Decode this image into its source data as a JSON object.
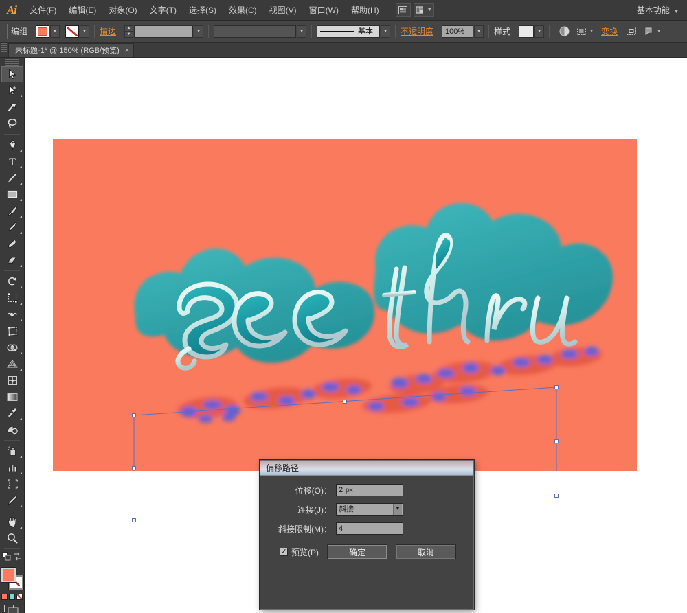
{
  "app": {
    "logo": "Ai",
    "workspace": "基本功能"
  },
  "menubar": {
    "items": [
      {
        "label": "文件(F)"
      },
      {
        "label": "编辑(E)"
      },
      {
        "label": "对象(O)"
      },
      {
        "label": "文字(T)"
      },
      {
        "label": "选择(S)"
      },
      {
        "label": "效果(C)"
      },
      {
        "label": "视图(V)"
      },
      {
        "label": "窗口(W)"
      },
      {
        "label": "帮助(H)"
      }
    ],
    "bridge_icon": "bridge-icon",
    "arrange_icon": "arrange-documents-icon"
  },
  "controlbar": {
    "selection_label": "编组",
    "fill_color": "#FA7A5E",
    "stroke_label": "描边",
    "stroke_weight": "",
    "profile_value": "",
    "brush_label": "基本",
    "opacity_label": "不透明度",
    "opacity_value": "100%",
    "style_label": "样式",
    "transform_label": "变换",
    "icons": [
      "opacity-mask-icon",
      "align-icon",
      "transform-icon",
      "isolate-icon",
      "flyout-icon"
    ]
  },
  "tabbar": {
    "document_title": "未标题-1* @ 150% (RGB/预览)",
    "close_glyph": "×"
  },
  "toolbar": {
    "tools": [
      {
        "name": "selection-tool",
        "active": true,
        "flyout": false
      },
      {
        "name": "direct-selection-tool",
        "active": false,
        "flyout": true
      },
      {
        "name": "magic-wand-tool",
        "active": false,
        "flyout": false
      },
      {
        "name": "lasso-tool",
        "active": false,
        "flyout": false
      },
      {
        "name": "pen-tool",
        "active": false,
        "flyout": true
      },
      {
        "name": "type-tool",
        "active": false,
        "flyout": true
      },
      {
        "name": "line-segment-tool",
        "active": false,
        "flyout": true
      },
      {
        "name": "rectangle-tool",
        "active": false,
        "flyout": true
      },
      {
        "name": "paintbrush-tool",
        "active": false,
        "flyout": true
      },
      {
        "name": "pencil-tool",
        "active": false,
        "flyout": true
      },
      {
        "name": "blob-brush-tool",
        "active": false,
        "flyout": false
      },
      {
        "name": "eraser-tool",
        "active": false,
        "flyout": true
      },
      {
        "name": "rotate-tool",
        "active": false,
        "flyout": true
      },
      {
        "name": "scale-tool",
        "active": false,
        "flyout": true
      },
      {
        "name": "width-tool",
        "active": false,
        "flyout": true
      },
      {
        "name": "free-transform-tool",
        "active": false,
        "flyout": false
      },
      {
        "name": "shape-builder-tool",
        "active": false,
        "flyout": true
      },
      {
        "name": "perspective-grid-tool",
        "active": false,
        "flyout": true
      },
      {
        "name": "mesh-tool",
        "active": false,
        "flyout": false
      },
      {
        "name": "gradient-tool",
        "active": false,
        "flyout": false
      },
      {
        "name": "eyedropper-tool",
        "active": false,
        "flyout": true
      },
      {
        "name": "blend-tool",
        "active": false,
        "flyout": false
      },
      {
        "name": "symbol-sprayer-tool",
        "active": false,
        "flyout": true
      },
      {
        "name": "column-graph-tool",
        "active": false,
        "flyout": true
      },
      {
        "name": "artboard-tool",
        "active": false,
        "flyout": false
      },
      {
        "name": "slice-tool",
        "active": false,
        "flyout": true
      },
      {
        "name": "hand-tool",
        "active": false,
        "flyout": true
      },
      {
        "name": "zoom-tool",
        "active": false,
        "flyout": false
      }
    ],
    "fill_color": "#FA7A5E",
    "stroke_color": "#FFFFFF",
    "color_modes": [
      "#FA7A5E",
      "#7FD4D4",
      "#FFFFFF"
    ]
  },
  "canvas": {
    "artboard_color": "#FA7A5E",
    "artwork_text": "see thru",
    "artwork_fill": "#1FA5AD",
    "artwork_extrude": "#2AA7AF",
    "artwork_outline": "#D8F5F2",
    "reflection_colors": [
      "#4A5BE8",
      "#E25540"
    ],
    "selection_stroke": "#5A6FC4"
  },
  "dialog": {
    "title": "偏移路径",
    "offset_label": "位移(O)：",
    "offset_value": "2",
    "offset_unit": "px",
    "joins_label": "连接(J)：",
    "joins_value": "斜接",
    "miter_label": "斜接限制(M)：",
    "miter_value": "4",
    "preview_label": "预览(P)",
    "preview_checked": "✓",
    "ok_label": "确定",
    "cancel_label": "取消"
  }
}
